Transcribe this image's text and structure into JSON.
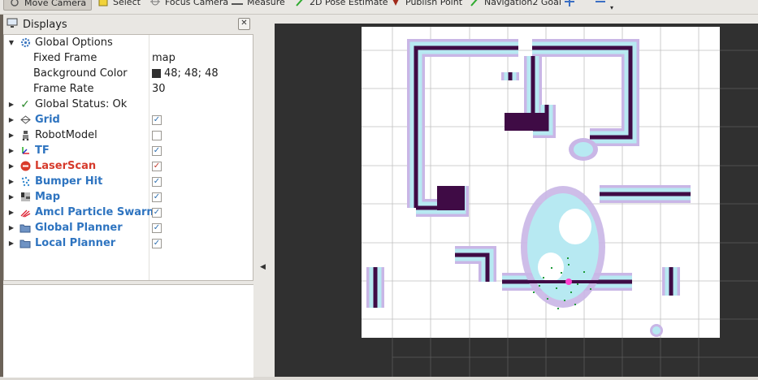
{
  "toolbar": {
    "tools": [
      {
        "label": "Move Camera",
        "icon": "move-camera-icon"
      },
      {
        "label": "Select",
        "icon": "select-icon"
      },
      {
        "label": "Focus Camera",
        "icon": "focus-camera-icon"
      },
      {
        "label": "Measure",
        "icon": "measure-icon"
      },
      {
        "label": "2D Pose Estimate",
        "icon": "pose-estimate-icon"
      },
      {
        "label": "Publish Point",
        "icon": "publish-point-icon"
      },
      {
        "label": "Navigation2 Goal",
        "icon": "nav-goal-icon"
      }
    ]
  },
  "displays": {
    "title": "Displays",
    "close_glyph": "✕",
    "global_options": {
      "label": "Global Options",
      "fixed_frame": {
        "label": "Fixed Frame",
        "value": "map"
      },
      "background_color": {
        "label": "Background Color",
        "value": "48; 48; 48",
        "color": "#303030"
      },
      "frame_rate": {
        "label": "Frame Rate",
        "value": "30"
      }
    },
    "global_status": {
      "label": "Global Status: Ok"
    },
    "items": [
      {
        "label": "Grid",
        "checked": true,
        "style": "blue",
        "icon": "grid-icon"
      },
      {
        "label": "RobotModel",
        "checked": false,
        "style": "plain",
        "icon": "robot-model-icon"
      },
      {
        "label": "TF",
        "checked": true,
        "style": "blue",
        "icon": "tf-icon"
      },
      {
        "label": "LaserScan",
        "checked": true,
        "style": "red",
        "icon": "error-icon"
      },
      {
        "label": "Bumper Hit",
        "checked": true,
        "style": "blue",
        "icon": "bumper-hit-icon"
      },
      {
        "label": "Map",
        "checked": true,
        "style": "blue",
        "icon": "map-icon"
      },
      {
        "label": "Amcl Particle Swarm",
        "checked": true,
        "style": "blue",
        "icon": "particle-swarm-icon"
      },
      {
        "label": "Global Planner",
        "checked": true,
        "style": "blue",
        "icon": "folder-icon"
      },
      {
        "label": "Local Planner",
        "checked": true,
        "style": "blue",
        "icon": "folder-icon"
      }
    ]
  },
  "colors": {
    "view_background": "#303030",
    "map_free": "#ffffff",
    "wall": "#3f0b45",
    "costmap_inflation": "#b7e9f2",
    "costmap_outer": "#c9b6e6",
    "particles": "#1e9c3a",
    "laser": "#ff3fcf",
    "grid_line": "#8a8a8a"
  }
}
